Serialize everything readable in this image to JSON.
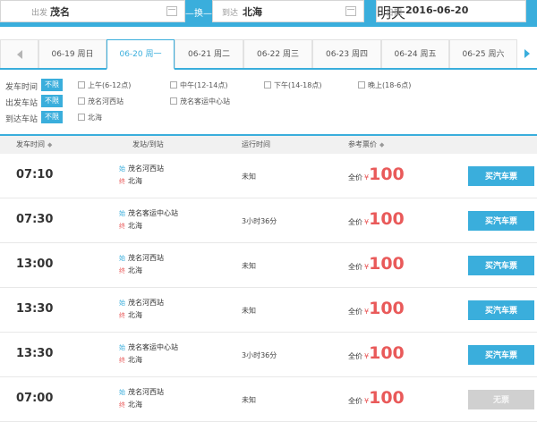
{
  "search": {
    "from_label": "出发",
    "from_value": "茂名",
    "swap_label": "—换—",
    "to_label": "到达",
    "to_value": "北海",
    "date_label": "日期",
    "date_value": "2016-06-20",
    "tomorrow_label": "明天"
  },
  "date_tabs": [
    {
      "label": "06-19 周日"
    },
    {
      "label": "06-20 周一"
    },
    {
      "label": "06-21 周二"
    },
    {
      "label": "06-22 周三"
    },
    {
      "label": "06-23 周四"
    },
    {
      "label": "06-24 周五"
    },
    {
      "label": "06-25 周六"
    }
  ],
  "filters": {
    "depart_time": {
      "label": "发车时间",
      "all": "不限",
      "options": [
        "上午(6-12点)",
        "中午(12-14点)",
        "下午(14-18点)",
        "晚上(18-6点)"
      ]
    },
    "depart_station": {
      "label": "出发车站",
      "all": "不限",
      "options": [
        "茂名河西站",
        "茂名客运中心站"
      ]
    },
    "arrive_station": {
      "label": "到达车站",
      "all": "不限",
      "options": [
        "北海"
      ]
    }
  },
  "table": {
    "headers": {
      "time": "发车时间",
      "stations": "发站/到站",
      "duration": "运行时间",
      "price": "参考票价"
    },
    "sort_icon": "◆",
    "from_tag": "始",
    "to_tag": "终",
    "price_label": "全价",
    "currency": "¥",
    "rows": [
      {
        "time": "07:10",
        "from": "茂名河西站",
        "to": "北海",
        "duration": "未知",
        "price": "100",
        "button": "买汽车票",
        "available": true
      },
      {
        "time": "07:30",
        "from": "茂名客运中心站",
        "to": "北海",
        "duration": "3小时36分",
        "price": "100",
        "button": "买汽车票",
        "available": true
      },
      {
        "time": "13:00",
        "from": "茂名河西站",
        "to": "北海",
        "duration": "未知",
        "price": "100",
        "button": "买汽车票",
        "available": true
      },
      {
        "time": "13:30",
        "from": "茂名河西站",
        "to": "北海",
        "duration": "未知",
        "price": "100",
        "button": "买汽车票",
        "available": true
      },
      {
        "time": "13:30",
        "from": "茂名客运中心站",
        "to": "北海",
        "duration": "3小时36分",
        "price": "100",
        "button": "买汽车票",
        "available": true
      },
      {
        "time": "07:00",
        "from": "茂名河西站",
        "to": "北海",
        "duration": "未知",
        "price": "100",
        "button": "无票",
        "available": false
      }
    ]
  },
  "colors": {
    "accent": "#3aaedc",
    "price": "#e95a5a",
    "disabled": "#d0d0d0"
  }
}
